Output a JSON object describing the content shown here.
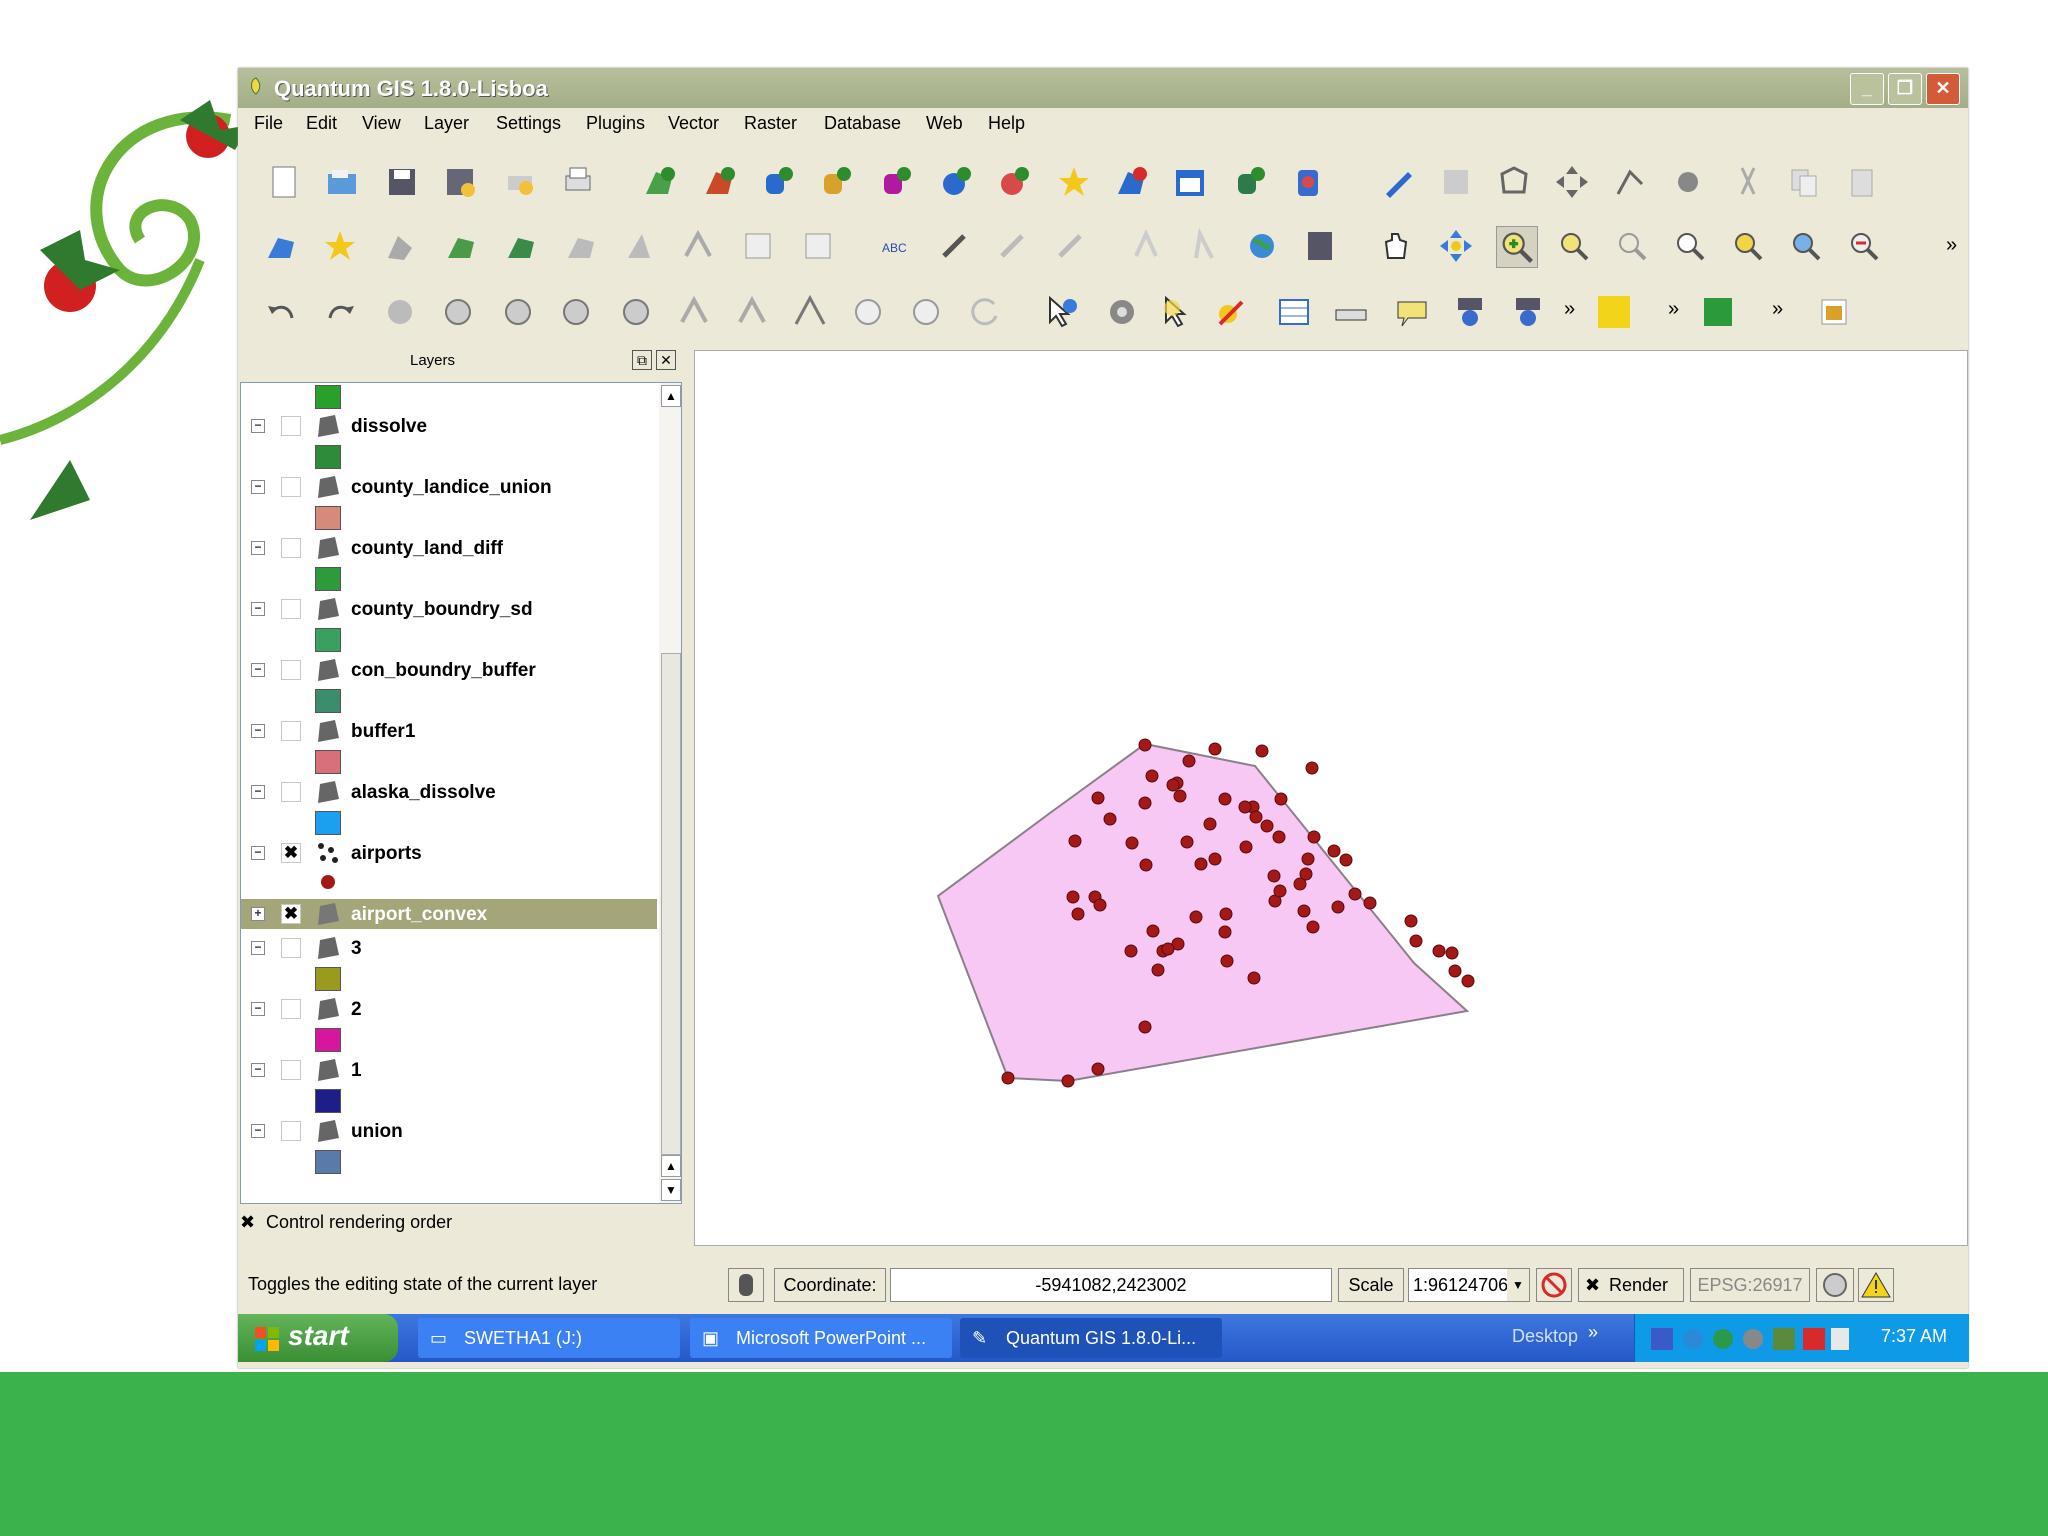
{
  "window": {
    "title": "Quantum GIS 1.8.0-Lisboa"
  },
  "menubar": [
    "File",
    "Edit",
    "View",
    "Layer",
    "Settings",
    "Plugins",
    "Vector",
    "Raster",
    "Database",
    "Web",
    "Help"
  ],
  "toolbar_overflow": "»",
  "layers_panel": {
    "title": "Layers",
    "layers": [
      {
        "name": "dissolve",
        "checked": false,
        "swatch": "#2e8b3a",
        "kind": "polygon"
      },
      {
        "name": "county_landice_union",
        "checked": false,
        "swatch": "#d58a7c",
        "kind": "polygon"
      },
      {
        "name": "county_land_diff",
        "checked": false,
        "swatch": "#2e9a3a",
        "kind": "polygon"
      },
      {
        "name": "county_boundry_sd",
        "checked": false,
        "swatch": "#3aa060",
        "kind": "polygon"
      },
      {
        "name": "con_boundry_buffer",
        "checked": false,
        "swatch": "#3c8d6b",
        "kind": "polygon"
      },
      {
        "name": "buffer1",
        "checked": false,
        "swatch": "#d8707a",
        "kind": "polygon"
      },
      {
        "name": "alaska_dissolve",
        "checked": false,
        "swatch": "#1aa0ee",
        "kind": "polygon"
      },
      {
        "name": "airports",
        "checked": true,
        "swatch": "#a51818",
        "kind": "point"
      },
      {
        "name": "airport_convex",
        "checked": true,
        "swatch": null,
        "kind": "polygon",
        "selected": true
      },
      {
        "name": "3",
        "checked": false,
        "swatch": "#9a9a1e",
        "kind": "polygon"
      },
      {
        "name": "2",
        "checked": false,
        "swatch": "#d6179e",
        "kind": "polygon"
      },
      {
        "name": "1",
        "checked": false,
        "swatch": "#1e1e88",
        "kind": "polygon"
      },
      {
        "name": "union",
        "checked": false,
        "swatch": "#5a7aaa",
        "kind": "polygon"
      }
    ],
    "control_rendering_order": "Control rendering order"
  },
  "statusbar": {
    "message": "Toggles the editing state of the current layer",
    "coordinate_label": "Coordinate:",
    "coordinate_value": "-5941082,2423002",
    "scale_label": "Scale",
    "scale_value": "1:96124706",
    "render_label": "Render",
    "epsg": "EPSG:26917"
  },
  "taskbar": {
    "start": "start",
    "tasks": [
      "SWETHA1 (J:)",
      "Microsoft PowerPoint ...",
      "Quantum GIS 1.8.0-Li..."
    ],
    "desktop": "Desktop",
    "time": "7:37 AM"
  },
  "colors": {
    "polygon_fill": "#f7c8f3",
    "polygon_stroke": "#8a7f8a",
    "point_color": "#a51818",
    "slide_green": "#3bb34a"
  }
}
